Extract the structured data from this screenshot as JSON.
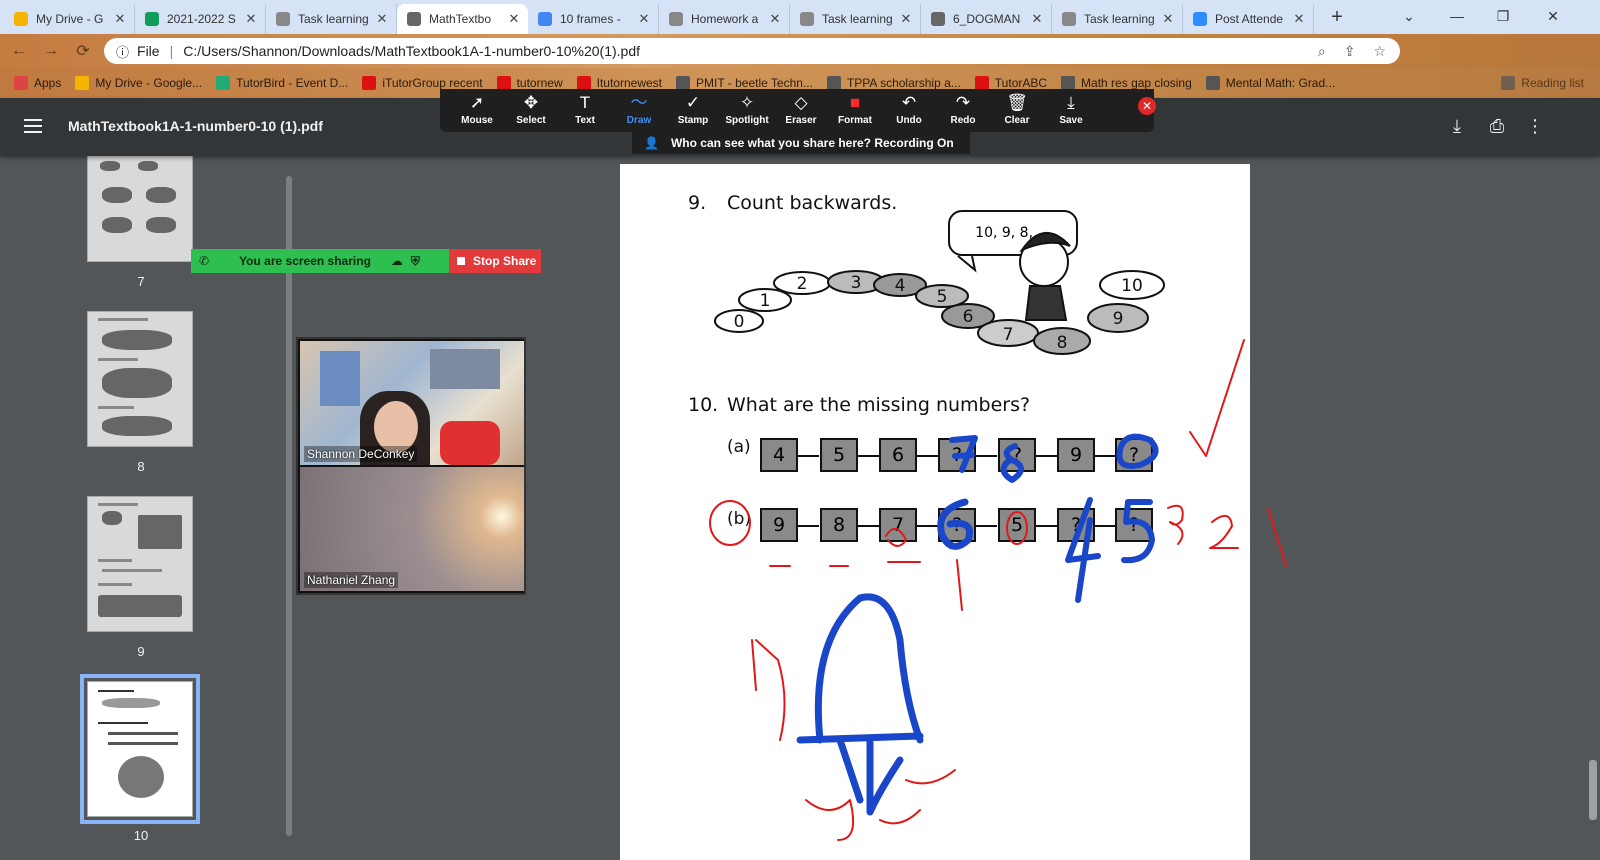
{
  "tabs": [
    {
      "title": "My Drive - G",
      "color": "#f4b400"
    },
    {
      "title": "2021-2022 S",
      "color": "#0f9d58"
    },
    {
      "title": "Task learning",
      "color": "#888888"
    },
    {
      "title": "MathTextbo",
      "color": "#666666",
      "active": true
    },
    {
      "title": "10 frames -",
      "color": "#4285f4"
    },
    {
      "title": "Homework a",
      "color": "#888888"
    },
    {
      "title": "Task learning",
      "color": "#888888"
    },
    {
      "title": "6_DOGMAN",
      "color": "#666666"
    },
    {
      "title": "Task learning",
      "color": "#888888"
    },
    {
      "title": "Post Attende",
      "color": "#2d8cff"
    }
  ],
  "address": {
    "label": "File",
    "url": "C:/Users/Shannon/Downloads/MathTextbook1A-1-number0-10%20(1).pdf"
  },
  "bookmarks": [
    {
      "label": "Apps",
      "color": "#d44"
    },
    {
      "label": "My Drive - Google...",
      "color": "#f4b400"
    },
    {
      "label": "TutorBird - Event D...",
      "color": "#2a7"
    },
    {
      "label": "iTutorGroup recent",
      "color": "#d11"
    },
    {
      "label": "tutornew",
      "color": "#d11"
    },
    {
      "label": "Itutornewest",
      "color": "#d11"
    },
    {
      "label": "PMIT - beetle Techn...",
      "color": "#555"
    },
    {
      "label": "TPPA scholarship a...",
      "color": "#555"
    },
    {
      "label": "TutorABC",
      "color": "#d11"
    },
    {
      "label": "Math res gap closing",
      "color": "#555"
    },
    {
      "label": "Mental Math: Grad...",
      "color": "#555"
    },
    {
      "label": "Reading list",
      "color": "#555"
    }
  ],
  "pdf": {
    "title": "MathTextbook1A-1-number0-10 (1).pdf"
  },
  "zoom_toolbar": {
    "tools": [
      "Mouse",
      "Select",
      "Text",
      "Draw",
      "Stamp",
      "Spotlight",
      "Eraser",
      "Format",
      "Undo",
      "Redo",
      "Clear",
      "Save"
    ],
    "active": "Draw",
    "notice": "Who can see what you share here? Recording On",
    "sharing": "You are screen sharing",
    "stop": "Stop Share"
  },
  "participants": [
    {
      "name": "Shannon DeConkey"
    },
    {
      "name": "Nathaniel Zhang"
    }
  ],
  "thumbnails": [
    "7",
    "8",
    "9",
    "10"
  ],
  "page": {
    "q9": {
      "num": "9.",
      "text": "Count backwards.",
      "bubble": "10, 9, 8, ..."
    },
    "stones": [
      "0",
      "1",
      "2",
      "3",
      "4",
      "5",
      "6",
      "7",
      "8",
      "9",
      "10"
    ],
    "q10": {
      "num": "10.",
      "text": "What are the missing numbers?"
    },
    "row_a": {
      "label": "(a)",
      "boxes": [
        "4",
        "5",
        "6",
        "?",
        "?",
        "9",
        "?"
      ]
    },
    "row_b": {
      "label": "(b)",
      "boxes": [
        "9",
        "8",
        "7",
        "?",
        "5",
        "?",
        "?"
      ]
    }
  }
}
